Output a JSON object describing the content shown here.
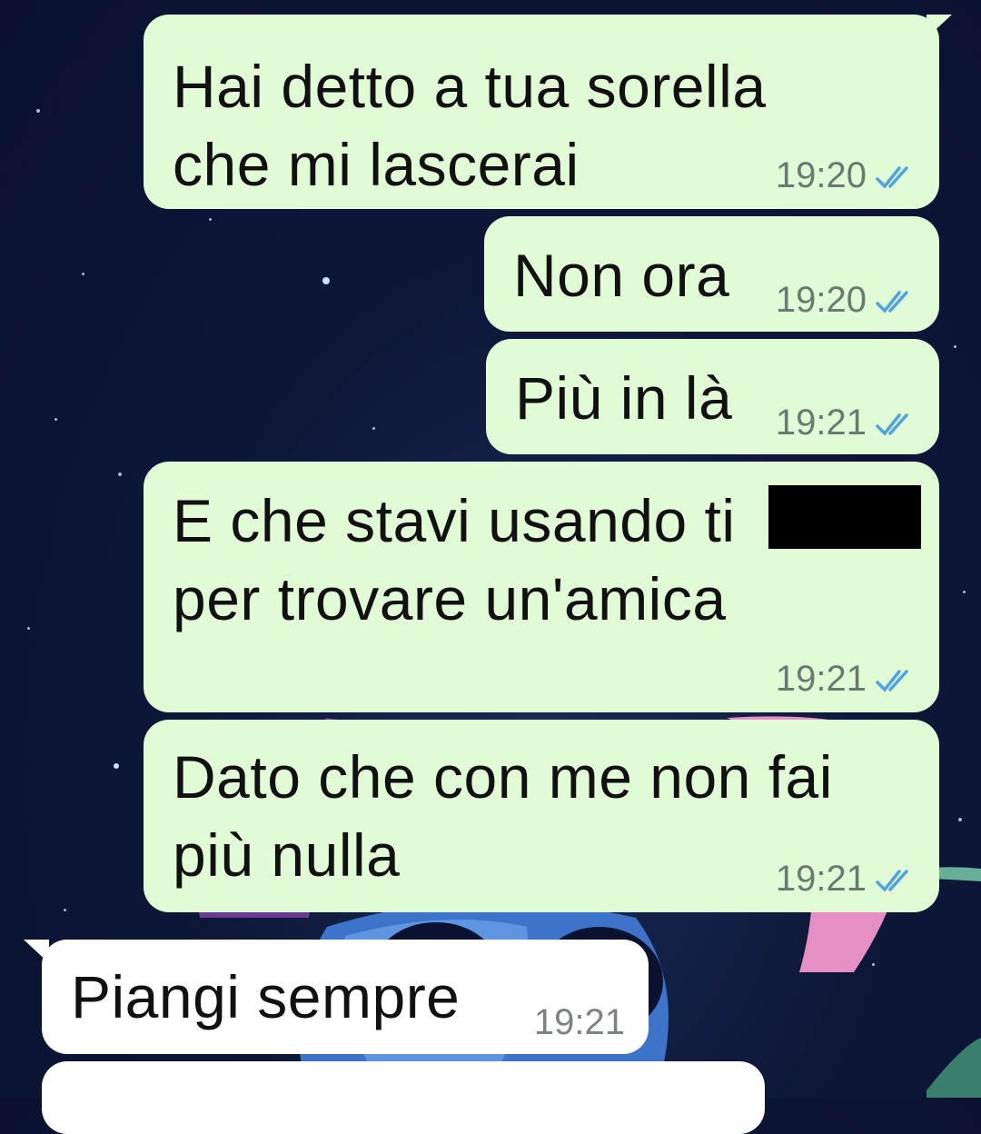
{
  "messages": [
    {
      "direction": "outgoing",
      "lines": [
        "Hai detto a tua sorella",
        "che mi lascerai"
      ],
      "time": "19:20",
      "status": "double-check-read-icon"
    },
    {
      "direction": "outgoing",
      "lines": [
        "Non ora"
      ],
      "time": "19:20",
      "status": "double-check-read-icon"
    },
    {
      "direction": "outgoing",
      "lines": [
        "Più in là"
      ],
      "time": "19:21",
      "status": "double-check-read-icon"
    },
    {
      "direction": "outgoing",
      "lines": [
        "E che stavi usando ti",
        "per trovare un'amica"
      ],
      "time": "19:21",
      "status": "double-check-read-icon",
      "redacted": true
    },
    {
      "direction": "outgoing",
      "lines": [
        "Dato che con me non fai",
        "più nulla"
      ],
      "time": "19:21",
      "status": "double-check-read-icon"
    },
    {
      "direction": "incoming",
      "lines": [
        "Piangi sempre"
      ],
      "time": "19:21"
    }
  ],
  "colors": {
    "outgoing_bubble": "#e1fbd6",
    "incoming_bubble": "#ffffff",
    "read_ticks": "#4fa3e0",
    "wallpaper": "#0e1738"
  }
}
